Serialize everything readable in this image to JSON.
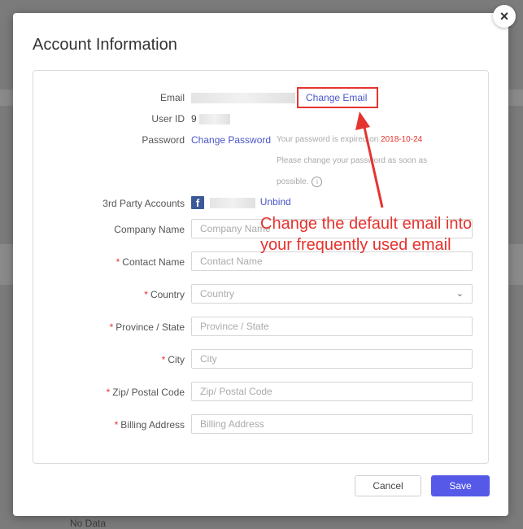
{
  "dialog": {
    "title": "Account Information",
    "close": "×"
  },
  "fields": {
    "email": {
      "label": "Email",
      "action": "Change Email"
    },
    "user_id": {
      "label": "User ID",
      "value_prefix": "9"
    },
    "password": {
      "label": "Password",
      "action": "Change Password",
      "note_1": "Your password is expired on",
      "expiry_date": "2018-10-24",
      "note_2": "Please change your password as soon as",
      "note_3": "possible."
    },
    "third_party": {
      "label": "3rd Party Accounts",
      "action": "Unbind"
    },
    "company": {
      "label": "Company Name",
      "placeholder": "Company Name"
    },
    "contact": {
      "label": "Contact Name",
      "placeholder": "Contact Name"
    },
    "country": {
      "label": "Country",
      "placeholder": "Country"
    },
    "province": {
      "label": "Province / State",
      "placeholder": "Province / State"
    },
    "city": {
      "label": "City",
      "placeholder": "City"
    },
    "zip": {
      "label": "Zip/ Postal Code",
      "placeholder": "Zip/ Postal Code"
    },
    "billing": {
      "label": "Billing Address",
      "placeholder": "Billing Address"
    },
    "required_mark": "*"
  },
  "buttons": {
    "cancel": "Cancel",
    "save": "Save"
  },
  "annotation": {
    "line1": "Change the default email into",
    "line2": "your frequently used email",
    "color": "#e5322d"
  },
  "background": {
    "no_data": "No Data"
  },
  "colors": {
    "link": "#4a55c8",
    "primary": "#5659e8",
    "required": "#e5322d"
  }
}
